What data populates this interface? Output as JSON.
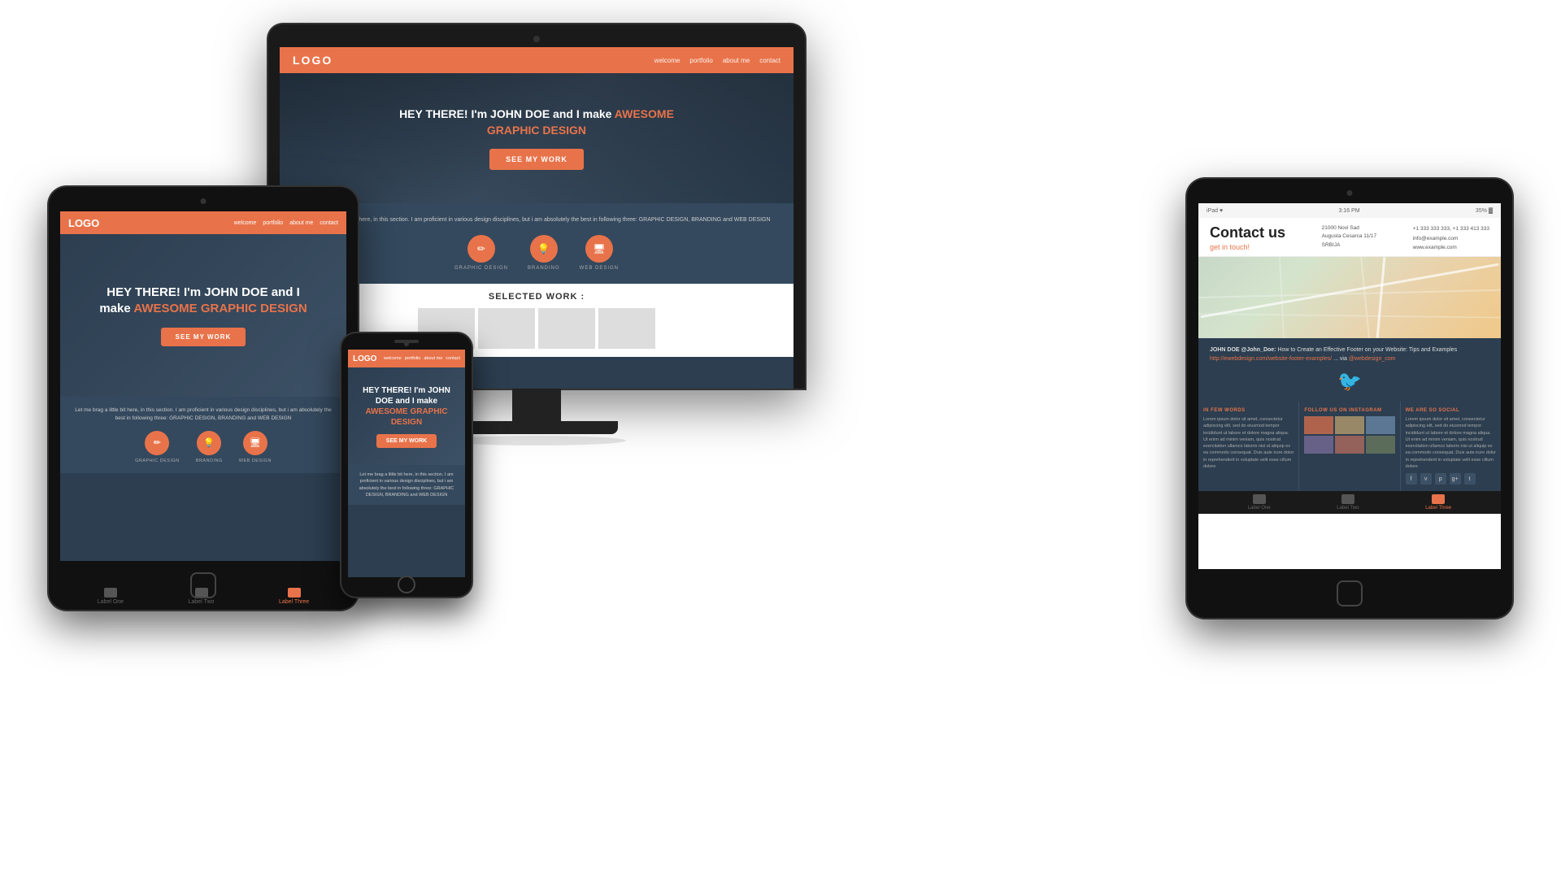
{
  "scene": {
    "background": "#ffffff"
  },
  "monitor": {
    "nav": {
      "logo": "LOGO",
      "links": [
        "welcome",
        "portfolio",
        "about me",
        "contact"
      ]
    },
    "hero": {
      "line1": "HEY THERE! I'm JOHN DOE and I make",
      "line2_accent": "AWESOME",
      "line3_accent": "GRAPHIC DESIGN",
      "cta": "SEE MY WORK"
    },
    "about": {
      "text": "Let me brag a little bit here, in this section. I am proficient in various design disciplines, but i am absolutely the best in following three: GRAPHIC DESIGN, BRANDING and WEB DESIGN"
    },
    "services": [
      {
        "icon": "✏",
        "label": "GRAPHIC DESIGN"
      },
      {
        "icon": "💡",
        "label": "BRANDING"
      },
      {
        "icon": "🖥",
        "label": "WEB DESIGN"
      }
    ],
    "work_title": "SELECTED WORK :"
  },
  "tablet_left": {
    "nav": {
      "logo": "LOGO",
      "links": [
        "welcome",
        "portfolio",
        "about me",
        "contact"
      ]
    },
    "hero": {
      "text": "HEY THERE! I'm JOHN DOE and I make",
      "accent": "AWESOME GRAPHIC DESIGN",
      "cta": "SEE MY WORK"
    },
    "about": {
      "text": "Let me brag a little bit here, in this section. I am proficient in various design disciplines, but i am absolutely the best in following three: GRAPHIC DESIGN, BRANDING and WEB DESIGN"
    },
    "services": [
      {
        "icon": "✏",
        "label": "GRAPHIC DESIGN"
      },
      {
        "icon": "💡",
        "label": "BRANDING"
      },
      {
        "icon": "🖥",
        "label": "WEB DESIGN"
      }
    ],
    "tabs": [
      {
        "label": "Label One",
        "active": false
      },
      {
        "label": "Label Two",
        "active": false
      },
      {
        "label": "Label Three",
        "active": true
      }
    ]
  },
  "phone": {
    "nav": {
      "logo": "LOGO",
      "links": [
        "welcome",
        "portfolio",
        "about me",
        "contact"
      ]
    },
    "hero": {
      "text": "HEY THERE! I'm JOHN DOE and I make",
      "accent": "AWESOME GRAPHIC DESIGN",
      "cta": "SEE MY WORK"
    },
    "about": {
      "text": "Let me brag a little bit here, in this section. I am proficient in various design disciplines, but i am absolutely the best in following three: GRAPHIC DESIGN, BRANDING and WEB DESIGN"
    }
  },
  "tablet_right": {
    "status_bar": {
      "left": "iPad ♥",
      "time": "3:16 PM",
      "right": "35% ▓"
    },
    "contact": {
      "title": "Contact us",
      "subtitle": "get in touch!",
      "address": "21000 Novi Sad\nAugusta Cesarca 11/17\nSRBIJA",
      "phone": "+1 333 333 333, +1 333 413 333",
      "email": "info@example.com",
      "website": "www.example.com"
    },
    "tweet": {
      "author": "JOHN DOE @John_Doe:",
      "text": "How to Create an Effective Footer on your Website: Tips and Examples",
      "link": "http://ewebdesign.com/website-footer-examples/",
      "via": "via @webdesign_com"
    },
    "footer": {
      "cols": [
        {
          "title": "IN FEW WORDS",
          "text": "Lorem ipsum dolor sit amet, consectetur adipiscing elit, sed do eiusmod tempor incididunt ut labore et dolore magna aliqua. Ut enim ad minim veniam, quis nostrud exercitation ullamco laboris nisi ut aliquip ex ea commodo consequat. Duis aute irure dolor in reprehenderit in voluptate velit esse cillum dolore"
        },
        {
          "title": "FOLLOW US ON INSTAGRAM",
          "text": ""
        },
        {
          "title": "WE ARE SO SOCIAL",
          "text": "Lorem ipsum dolor sit amet, consectetur adipiscing elit, sed do eiusmod tempor incididunt ut labore et dolore magna aliqua. Ut enim ad minim veniam, quis nostrud exercitation ullamco laboris nisi ut aliquip ex ea commodo consequat. Duis aute irure dolor in reprehenderit in voluptate velit esse cillum dolore",
          "social_icons": [
            "f",
            "v",
            "p",
            "g+",
            "t"
          ]
        }
      ]
    },
    "tabs": [
      {
        "label": "Label One",
        "active": false
      },
      {
        "label": "Label Two",
        "active": false
      },
      {
        "label": "Label Three",
        "active": true
      }
    ]
  }
}
